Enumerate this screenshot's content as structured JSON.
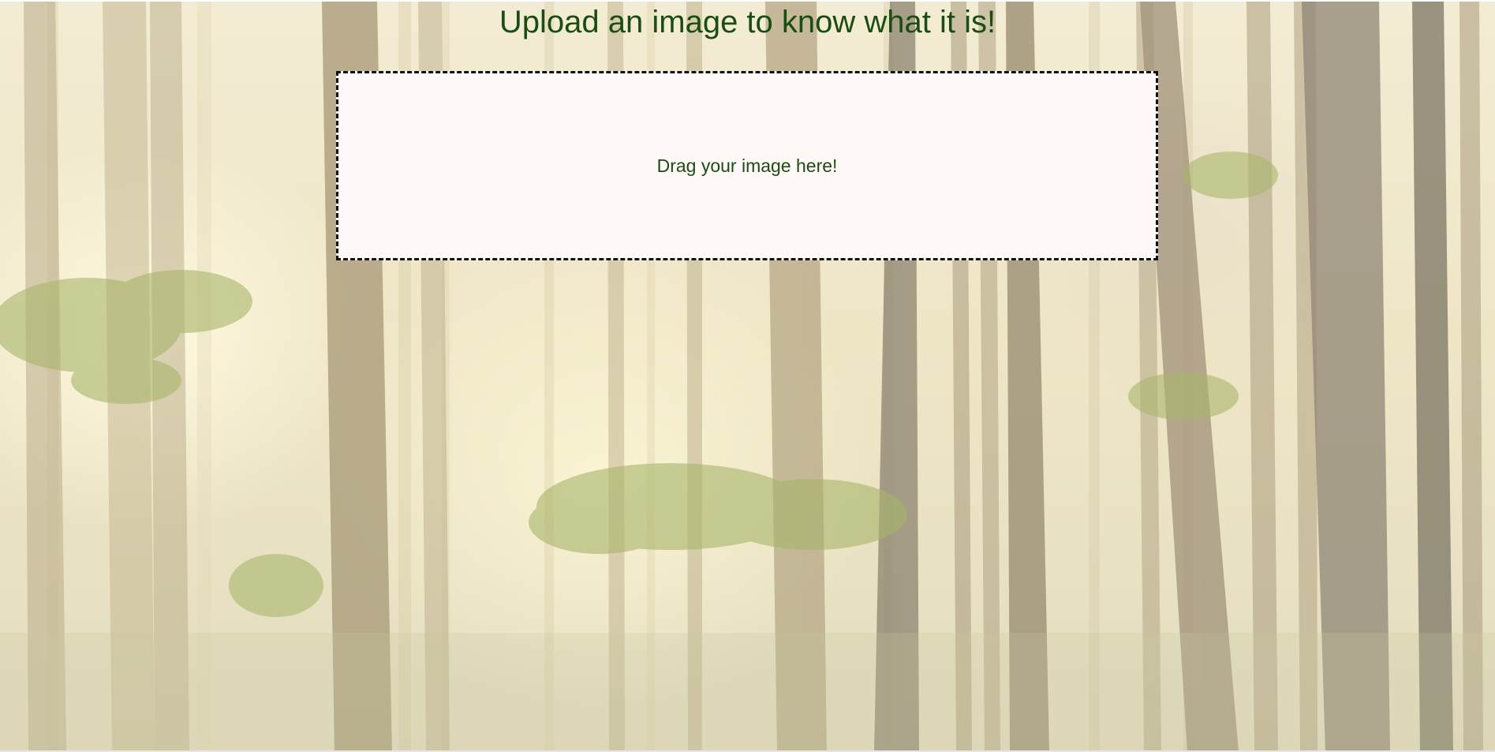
{
  "page": {
    "title": "Upload an image to know what it is!"
  },
  "dropzone": {
    "label": "Drag your image here!"
  },
  "background": {
    "scene": "forest-photo"
  },
  "colors": {
    "title_text": "#1a4d12",
    "dropzone_fill": "#fff9f8",
    "dropzone_border": "#111111"
  }
}
